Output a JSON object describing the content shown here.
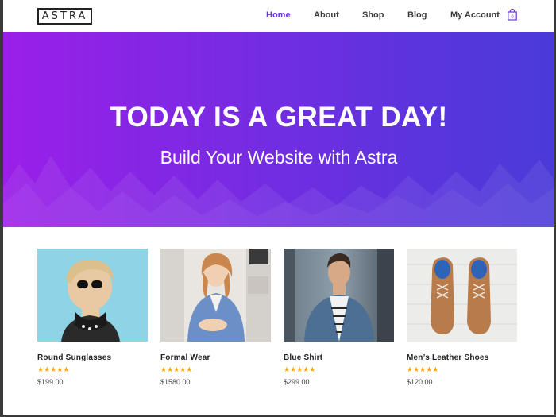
{
  "header": {
    "logo_text": "ASTRA",
    "nav": [
      {
        "label": "Home",
        "active": true
      },
      {
        "label": "About",
        "active": false
      },
      {
        "label": "Shop",
        "active": false
      },
      {
        "label": "Blog",
        "active": false
      },
      {
        "label": "My Account",
        "active": false
      }
    ],
    "cart_count": "0",
    "cart_icon": "shopping-bag-icon"
  },
  "hero": {
    "title": "TODAY IS A GREAT DAY!",
    "subtitle": "Build Your Website with Astra",
    "gradient_start": "#9a1fe8",
    "gradient_end": "#4a3bd8"
  },
  "products": [
    {
      "name": "Round Sunglasses",
      "stars": "★★★★★",
      "rating": 5,
      "price": "$199.00",
      "image": "woman-sunglasses-photo"
    },
    {
      "name": "Formal Wear",
      "stars": "★★★★★",
      "rating": 5,
      "price": "$1580.00",
      "image": "woman-blue-blazer-photo"
    },
    {
      "name": "Blue Shirt",
      "stars": "★★★★★",
      "rating": 5,
      "price": "$299.00",
      "image": "man-denim-shirt-photo"
    },
    {
      "name": "Men’s Leather Shoes",
      "stars": "★★★★★",
      "rating": 5,
      "price": "$120.00",
      "image": "leather-shoes-photo"
    }
  ],
  "colors": {
    "accent": "#6b35d8",
    "star": "#f0a418",
    "text": "#222222"
  }
}
